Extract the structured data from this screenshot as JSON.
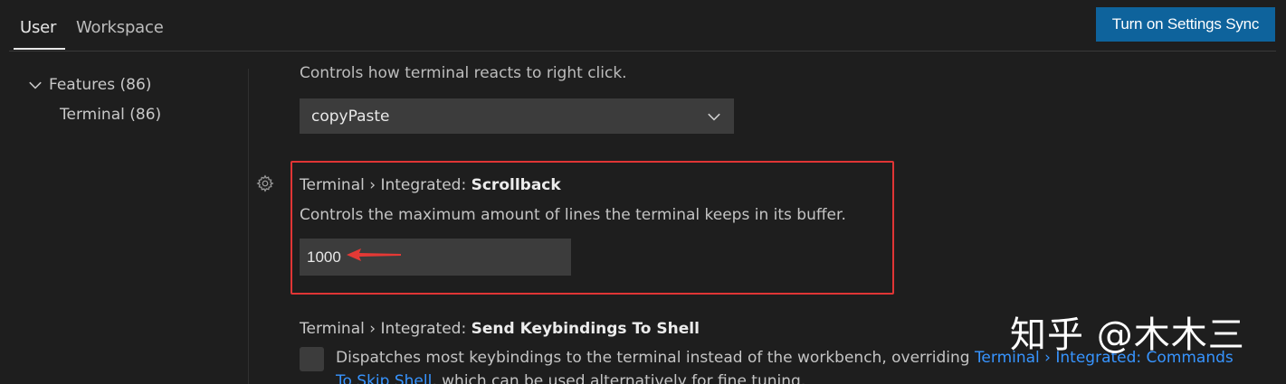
{
  "header": {
    "tabs": [
      {
        "label": "User",
        "active": true
      },
      {
        "label": "Workspace",
        "active": false
      }
    ],
    "sync_button": "Turn on Settings Sync"
  },
  "sidebar": {
    "features": "Features (86)",
    "terminal": "Terminal (86)"
  },
  "settings": {
    "right_click": {
      "description": "Controls how terminal reacts to right click.",
      "value": "copyPaste"
    },
    "scrollback": {
      "category": "Terminal › Integrated: ",
      "name": "Scrollback",
      "description": "Controls the maximum amount of lines the terminal keeps in its buffer.",
      "value": "1000"
    },
    "send_keybindings": {
      "category": "Terminal › Integrated: ",
      "name": "Send Keybindings To Shell",
      "description_before": "Dispatches most keybindings to the terminal instead of the workbench, overriding ",
      "link_part1": "Terminal › Integrated: Commands",
      "link_part2": "To Skip Shell",
      "description_after": ", which can be used alternatively for fine tuning.",
      "checked": false
    }
  },
  "watermark": "知乎 @木木三",
  "colors": {
    "background": "#1e1e1e",
    "accent": "#0e639c",
    "highlight": "#e03535",
    "link": "#3794ff"
  }
}
